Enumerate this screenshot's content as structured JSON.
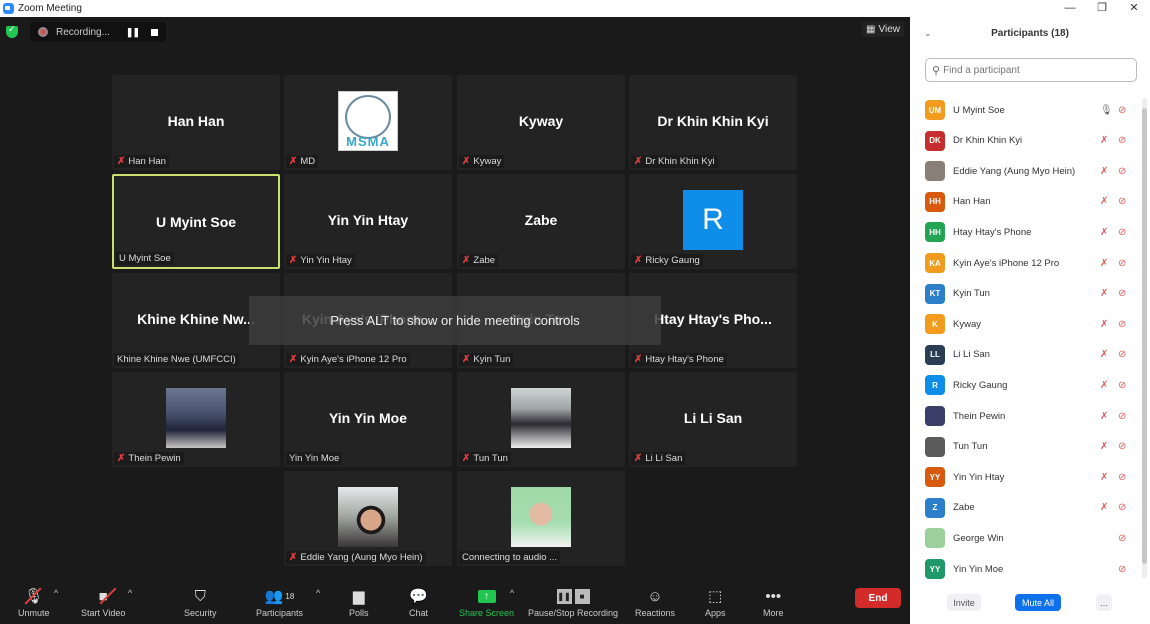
{
  "window": {
    "title": "Zoom Meeting",
    "controls": {
      "minimize": "—",
      "restore": "❐",
      "close": "✕"
    }
  },
  "meeting": {
    "security_icon": "green-shield-icon",
    "recording": {
      "status": "Recording...",
      "pause_icon": "❚❚",
      "stop_icon": "stop-icon"
    },
    "view_button": {
      "icon": "▦",
      "label": "View"
    },
    "alt_banner": "Press ALT to show or hide meeting controls",
    "tiles": [
      {
        "display": "Han Han",
        "label": "Han Han",
        "muted": true,
        "type": "name"
      },
      {
        "display": "",
        "label": "MD",
        "muted": true,
        "type": "logo",
        "logo_text": "MSMA"
      },
      {
        "display": "Kyway",
        "label": "Kyway",
        "muted": true,
        "type": "name"
      },
      {
        "display": "Dr Khin Khin Kyi",
        "label": "Dr Khin Khin Kyi",
        "muted": true,
        "type": "name"
      },
      {
        "display": "U Myint Soe",
        "label": "U Myint Soe",
        "muted": false,
        "type": "name",
        "active_speaker": true
      },
      {
        "display": "Yin Yin Htay",
        "label": "Yin Yin Htay",
        "muted": true,
        "type": "name"
      },
      {
        "display": "Zabe",
        "label": "Zabe",
        "muted": true,
        "type": "name"
      },
      {
        "display": "R",
        "label": "Ricky Gaung",
        "muted": true,
        "type": "letter-avatar"
      },
      {
        "display": "Khine  Khine  Nw...",
        "label": "Khine Khine Nwe (UMFCCI)",
        "muted": false,
        "type": "name"
      },
      {
        "display": "Kyin Aye's iPhone...",
        "label": "Kyin Aye's iPhone 12 Pro",
        "muted": true,
        "type": "name"
      },
      {
        "display": "Kyin Tun",
        "label": "Kyin Tun",
        "muted": true,
        "type": "name"
      },
      {
        "display": "Htay  Htay's  Pho...",
        "label": "Htay Htay's Phone",
        "muted": true,
        "type": "name"
      },
      {
        "display": "",
        "label": "Thein Pewin",
        "muted": true,
        "type": "photo",
        "photo": "thein"
      },
      {
        "display": "Yin Yin Moe",
        "label": "Yin Yin Moe",
        "muted": false,
        "type": "name"
      },
      {
        "display": "",
        "label": "Tun Tun",
        "muted": true,
        "type": "photo",
        "photo": "tun"
      },
      {
        "display": "Li Li San",
        "label": "Li Li San",
        "muted": true,
        "type": "name"
      },
      {
        "display": "",
        "label": "Eddie Yang (Aung Myo Hein)",
        "muted": true,
        "type": "photo",
        "photo": "eddie"
      },
      {
        "display": "",
        "label": "Connecting to audio ...",
        "muted": false,
        "type": "photo",
        "photo": "george"
      }
    ],
    "toolbar": {
      "unmute": "Unmute",
      "start_video": "Start Video",
      "security": "Security",
      "participants": "Participants",
      "participants_count": "18",
      "polls": "Polls",
      "chat": "Chat",
      "share_screen": "Share Screen",
      "pause_stop_recording": "Pause/Stop Recording",
      "reactions": "Reactions",
      "apps": "Apps",
      "more": "More",
      "end": "End"
    }
  },
  "panel": {
    "title": "Participants (18)",
    "search_placeholder": "Find a participant",
    "participants": [
      {
        "initials": "UM",
        "name": "U Myint Soe",
        "color": "#f29c1f",
        "mic": "on",
        "video": "off"
      },
      {
        "initials": "DK",
        "name": "Dr Khin Khin Kyi",
        "color": "#c62d2d",
        "mic": "muted",
        "video": "off"
      },
      {
        "initials": "",
        "name": "Eddie Yang (Aung Myo Hein)",
        "color": "#8a7f76",
        "mic": "muted",
        "video": "off",
        "photo": true
      },
      {
        "initials": "HH",
        "name": "Han Han",
        "color": "#d85a0f",
        "mic": "muted",
        "video": "off"
      },
      {
        "initials": "HH",
        "name": "Htay Htay's Phone",
        "color": "#23a455",
        "mic": "muted",
        "video": "off"
      },
      {
        "initials": "KA",
        "name": "Kyin Aye's iPhone 12 Pro",
        "color": "#f29c1f",
        "mic": "muted",
        "video": "off"
      },
      {
        "initials": "KT",
        "name": "Kyin Tun",
        "color": "#2c7fc9",
        "mic": "muted",
        "video": "off"
      },
      {
        "initials": "K",
        "name": "Kyway",
        "color": "#f29c1f",
        "mic": "muted",
        "video": "off"
      },
      {
        "initials": "LL",
        "name": "Li Li San",
        "color": "#2c3e55",
        "mic": "muted",
        "video": "off"
      },
      {
        "initials": "R",
        "name": "Ricky Gaung",
        "color": "#0e8ee9",
        "mic": "muted",
        "video": "off"
      },
      {
        "initials": "",
        "name": "Thein Pewin",
        "color": "#3a3f6a",
        "mic": "muted",
        "video": "off",
        "photo": true
      },
      {
        "initials": "",
        "name": "Tun Tun",
        "color": "#5b5b5b",
        "mic": "muted",
        "video": "off",
        "photo": true
      },
      {
        "initials": "YY",
        "name": "Yin Yin Htay",
        "color": "#d85a0f",
        "mic": "muted",
        "video": "off"
      },
      {
        "initials": "Z",
        "name": "Zabe",
        "color": "#2c7fc9",
        "mic": "muted",
        "video": "off"
      },
      {
        "initials": "",
        "name": "George Win",
        "color": "#9ccf9c",
        "mic": "none",
        "video": "off",
        "photo": true
      },
      {
        "initials": "YY",
        "name": "Yin Yin Moe",
        "color": "#1e9a6a",
        "mic": "none",
        "video": "off"
      }
    ],
    "footer": {
      "invite": "Invite",
      "mute_all": "Mute All",
      "more": "..."
    }
  }
}
